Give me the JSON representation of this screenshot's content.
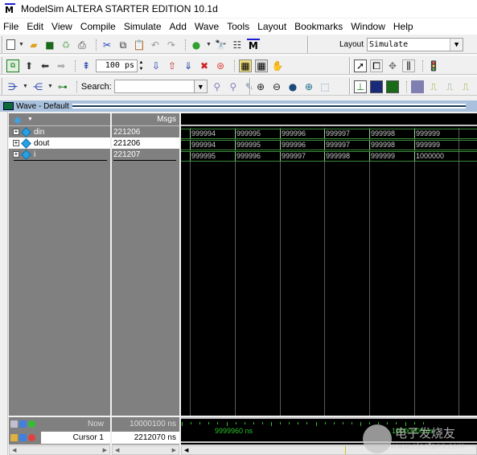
{
  "window": {
    "title": "ModelSim ALTERA STARTER EDITION 10.1d",
    "logo_letter": "M"
  },
  "menu": [
    {
      "label": "File"
    },
    {
      "label": "Edit"
    },
    {
      "label": "View"
    },
    {
      "label": "Compile"
    },
    {
      "label": "Simulate"
    },
    {
      "label": "Add"
    },
    {
      "label": "Wave"
    },
    {
      "label": "Tools"
    },
    {
      "label": "Layout"
    },
    {
      "label": "Bookmarks"
    },
    {
      "label": "Window"
    },
    {
      "label": "Help"
    }
  ],
  "toolbar": {
    "layout_label": "Layout",
    "layout_value": "Simulate",
    "run_length": "100 ps",
    "search_label": "Search:",
    "search_value": ""
  },
  "wave": {
    "title": "Wave - Default",
    "msgs_header": "Msgs",
    "signals": [
      {
        "name": "din",
        "value": "221206",
        "selected": false,
        "segments": [
          "999994",
          "999995",
          "999996",
          "999997",
          "999998",
          "999999"
        ]
      },
      {
        "name": "dout",
        "value": "221206",
        "selected": true,
        "segments": [
          "999994",
          "999995",
          "999996",
          "999997",
          "999998",
          "999999"
        ]
      },
      {
        "name": "i",
        "value": "221207",
        "selected": false,
        "segments": [
          "999995",
          "999996",
          "999997",
          "999998",
          "999999",
          "1000000"
        ]
      }
    ],
    "now_label": "Now",
    "now_value": "10000100 ns",
    "cursor_label": "Cursor 1",
    "cursor_value": "2212070 ns",
    "timeline_labels": [
      "9999960 ns",
      "10000000 ns"
    ]
  },
  "watermark": {
    "text": "电子发烧友",
    "url": "www.elecfans.com"
  }
}
